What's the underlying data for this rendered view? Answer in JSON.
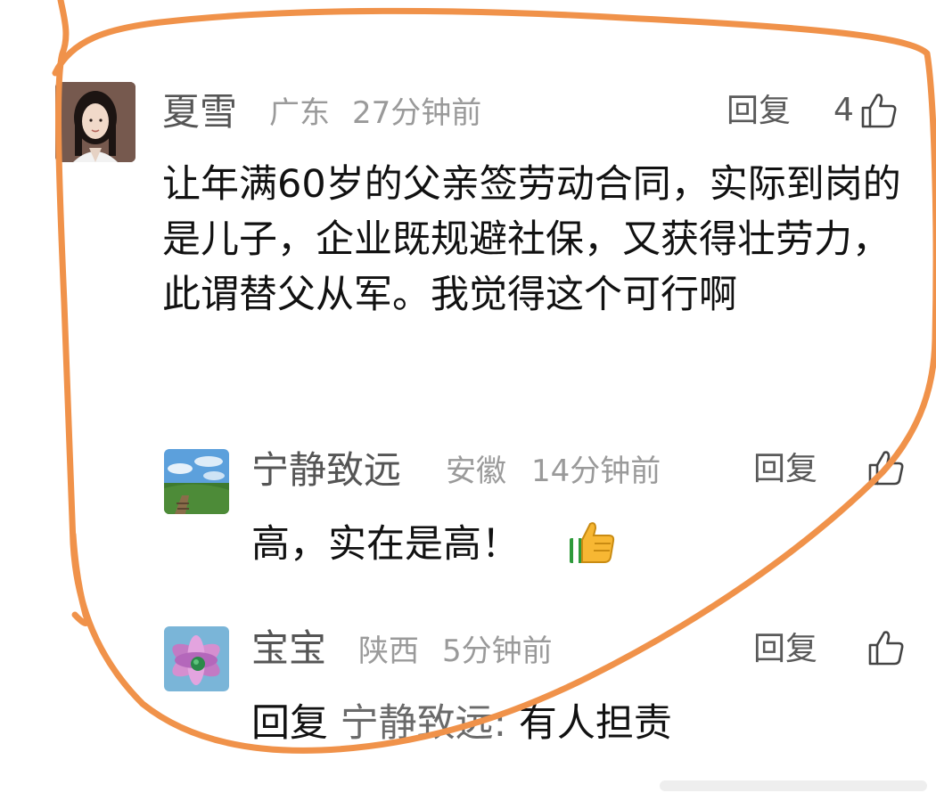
{
  "comment": {
    "author": "夏雪",
    "location": "广东",
    "time": "27分钟前",
    "reply_label": "回复",
    "like_count": "4",
    "text": "让年满60岁的父亲签劳动合同，实际到岗的是儿子，企业既规避社保，又获得壮劳力，此谓替父从军。我觉得这个可行啊"
  },
  "replies": [
    {
      "author": "宁静致远",
      "location": "安徽",
      "time": "14分钟前",
      "reply_label": "回复",
      "text": "高，实在是高！",
      "emoji": "thumbs-up-emoji"
    },
    {
      "author": "宝宝",
      "location": "陕西",
      "time": "5分钟前",
      "reply_label": "回复",
      "reply_prefix": "回复",
      "reply_target": "宁静致远:",
      "text": "有人担责"
    }
  ],
  "colors": {
    "annotation": "#f0924a",
    "name": "#555555",
    "meta": "#9a9a9a"
  }
}
